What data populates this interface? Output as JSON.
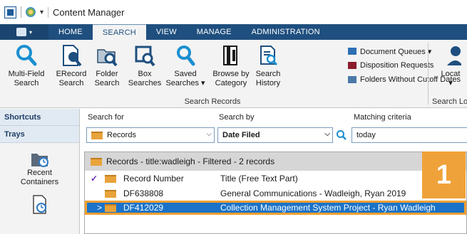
{
  "window": {
    "title": "Content Manager",
    "qa_menu_glyph": "▾"
  },
  "ribbon_tabs": [
    "HOME",
    "SEARCH",
    "VIEW",
    "MANAGE",
    "ADMINISTRATION"
  ],
  "ribbon": {
    "buttons": [
      {
        "label1": "Multi-Field",
        "label2": "Search",
        "icon": "magnifier-icon"
      },
      {
        "label1": "ERecord",
        "label2": "Search",
        "icon": "erecord-search-icon"
      },
      {
        "label1": "Folder",
        "label2": "Search",
        "icon": "folder-search-icon"
      },
      {
        "label1": "Box",
        "label2": "Searches",
        "icon": "box-search-icon"
      },
      {
        "label1": "Saved",
        "label2": "Searches ▾",
        "icon": "saved-search-icon"
      },
      {
        "label1": "Browse by",
        "label2": "Category",
        "icon": "browse-category-icon"
      },
      {
        "label1": "Search",
        "label2": "History",
        "icon": "search-history-icon"
      }
    ],
    "small_items": [
      {
        "label": "Document Queues ▾",
        "icon": "document-queues-icon"
      },
      {
        "label": "Disposition Requests",
        "icon": "disposition-icon"
      },
      {
        "label": "Folders Without Cutoff Dates",
        "icon": "folders-cutoff-icon"
      }
    ],
    "group_label": "Search Records",
    "locate": {
      "label": "Locat",
      "sub": "▾"
    },
    "group2_label": "Search Lo"
  },
  "leftnav": {
    "shortcuts": "Shortcuts",
    "trays": "Trays",
    "tile1": {
      "line1": "Recent",
      "line2": "Containers"
    }
  },
  "search": {
    "for_label": "Search for",
    "by_label": "Search by",
    "criteria_label": "Matching criteria",
    "for_value": "Records",
    "by_value": "Date Filed",
    "criteria_value": "today"
  },
  "records": {
    "title": "Records - title:wadleigh - Filtered - 2 records",
    "col_number": "Record Number",
    "col_title": "Title (Free Text Part)",
    "rows": [
      {
        "number": "DF638808",
        "title": "General Communications - Wadleigh, Ryan 2019"
      },
      {
        "number": "DF412029",
        "title": "Collection Management System Project - Ryan Wadleigh"
      }
    ],
    "badge": "1"
  },
  "colors": {
    "accent": "#1f4f7f",
    "selection": "#1a73c8",
    "highlight": "#f0a030",
    "search_icon": "#1a8fd0"
  }
}
